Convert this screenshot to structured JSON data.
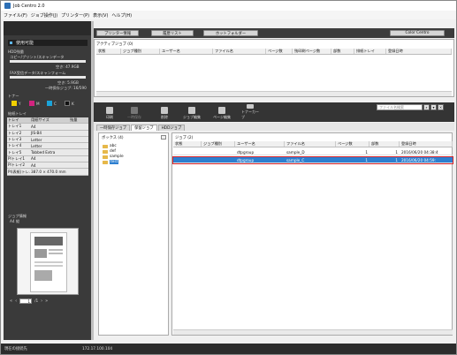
{
  "window": {
    "title": "Job Centro 2.0"
  },
  "menu": [
    "ファイル(F)",
    "ジョブ操作(J)",
    "プリンター(P)",
    "表示(V)",
    "ヘルプ(H)"
  ],
  "left": {
    "status": "使用可能",
    "hdd_label": "HDD残量",
    "copy_label": "コピー/プリント/スキャンデータ",
    "free1": "空き: 47.9GB",
    "fax_label": "FAX受信データ/スキャンフォーム",
    "free2": "空き: 5.9GB",
    "temp_label": "一時保存ジョブ: 16/590",
    "toner_label": "トナー",
    "toner": [
      {
        "name": "Y",
        "color": "#f2d000"
      },
      {
        "name": "M",
        "color": "#d2237f"
      },
      {
        "name": "C",
        "color": "#1aa3d9"
      },
      {
        "name": "K",
        "color": "#111111"
      }
    ],
    "tray_title": "給紙トレイ",
    "tray_headers": [
      "トレイ",
      "用紙サイズ",
      "残量"
    ],
    "trays": [
      [
        "トレイ1",
        "A4",
        ""
      ],
      [
        "トレイ2",
        "JIS-B4",
        ""
      ],
      [
        "トレイ3",
        "Letter",
        ""
      ],
      [
        "トレイ4",
        "Letter",
        ""
      ],
      [
        "トレイ5",
        "Tabbed Extra",
        ""
      ],
      [
        "PIトレイ1",
        "A4",
        ""
      ],
      [
        "PIトレイ2",
        "A4",
        ""
      ],
      [
        "PI(表紙)トレ…",
        "387.0 × 470.0 mm",
        ""
      ]
    ],
    "job_info_title": "ジョブ情報",
    "job_info_size": "A4 縦",
    "page": "1",
    "page_total": "/1"
  },
  "top_buttons": {
    "printer_info": "プリンター情報",
    "history": "履歴リスト",
    "hot_folder": "ホットフォルダー",
    "color_centro": "Color Centro"
  },
  "active": {
    "title": "アクティブジョブ (0)",
    "columns": [
      "状態",
      "ジョブ種別",
      "ユーザー名",
      "ファイル名",
      "ページ数",
      "残印刷ページ数",
      "部数",
      "排紙トレイ",
      "登録日時"
    ]
  },
  "toolbar": {
    "tools": [
      "印刷",
      "一時保存",
      "削除",
      "ジョブ編集",
      "ページ編集",
      "トナーカーブ"
    ],
    "search_placeholder": "ファイル名検索"
  },
  "tabs": [
    "一時保存ジョブ",
    "保留ジョブ",
    "HDDジョブ"
  ],
  "boxes": {
    "title": "ボックス (4)",
    "items": [
      "abc",
      "def",
      "sample",
      "test"
    ]
  },
  "jobs": {
    "title": "ジョブ (2)",
    "columns": [
      "状態",
      "ジョブ種別",
      "ユーザー名",
      "ファイル名",
      "ページ数",
      "部数",
      "登録日時"
    ],
    "rows": [
      [
        "",
        "",
        "dtpgroup",
        "sample_D",
        "1",
        "1",
        "2016/06/20 04:38:4"
      ],
      [
        "",
        "",
        "dtpgroup",
        "sample_C",
        "1",
        "1",
        "2016/06/20 04:59:"
      ]
    ]
  },
  "status": {
    "connection": "現在の接続先",
    "ip": "172.17.100.104"
  }
}
